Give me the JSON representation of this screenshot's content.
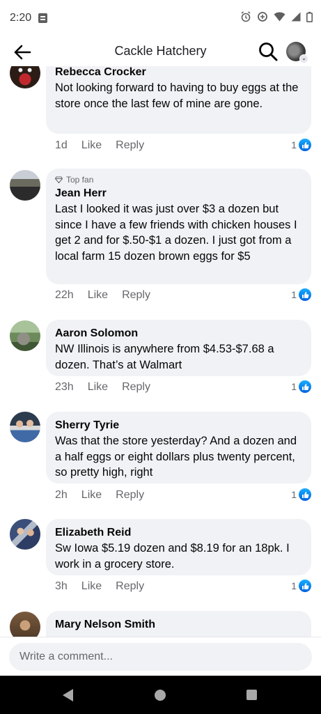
{
  "status_bar": {
    "time": "2:20",
    "icons": [
      "alarm-icon",
      "data-saver-icon",
      "wifi-icon",
      "signal-icon",
      "battery-icon"
    ]
  },
  "header": {
    "title": "Cackle Hatchery",
    "back_icon": "back-arrow-icon",
    "search_icon": "search-icon"
  },
  "comments": [
    {
      "name": "Rebecca Crocker",
      "badge": "",
      "text": "Not looking forward to having to buy eggs at the store once the last few of mine are gone.",
      "time": "1d",
      "like_label": "Like",
      "reply_label": "Reply",
      "reactions": "1"
    },
    {
      "name": "Jean Herr",
      "badge": "Top fan",
      "text": "Last I looked it was just over $3 a dozen but since I have a few friends with chicken houses I get 2 and for $.50-$1 a dozen. I just got from a local farm 15 dozen brown eggs for $5",
      "time": "22h",
      "like_label": "Like",
      "reply_label": "Reply",
      "reactions": "1"
    },
    {
      "name": "Aaron Solomon",
      "badge": "",
      "text": "NW Illinois is anywhere from $4.53-$7.68 a dozen.  That’s at Walmart",
      "time": "23h",
      "like_label": "Like",
      "reply_label": "Reply",
      "reactions": "1"
    },
    {
      "name": "Sherry Tyrie",
      "badge": "",
      "text": "Was that the store yesterday? And a dozen and a half eggs or eight dollars plus twenty percent, so pretty high, right",
      "time": "2h",
      "like_label": "Like",
      "reply_label": "Reply",
      "reactions": "1"
    },
    {
      "name": "Elizabeth Reid",
      "badge": "",
      "text": "Sw Iowa $5.19 dozen and $8.19 for an 18pk. I work in a grocery store.",
      "time": "3h",
      "like_label": "Like",
      "reply_label": "Reply",
      "reactions": "1"
    },
    {
      "name": "Mary Nelson Smith",
      "badge": "",
      "text": ""
    }
  ],
  "composer": {
    "placeholder": "Write a comment..."
  },
  "colors": {
    "bubble": "#f0f2f5",
    "secondary_text": "#65676b",
    "like_blue": "#1877f2"
  }
}
